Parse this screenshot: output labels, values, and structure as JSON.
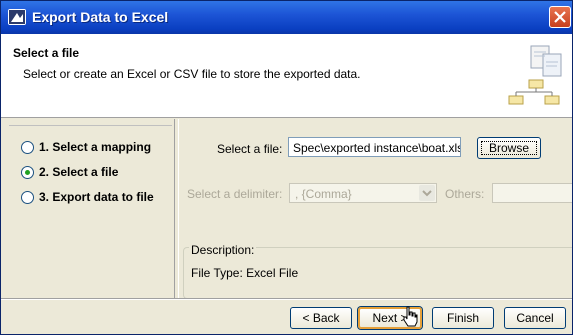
{
  "window": {
    "title": "Export Data to Excel"
  },
  "header": {
    "title": "Select a file",
    "description": "Select or create an Excel or CSV file to store the exported data."
  },
  "steps": [
    {
      "label": "1. Select a mapping",
      "selected": false
    },
    {
      "label": "2. Select a file",
      "selected": true
    },
    {
      "label": "3. Export data to file",
      "selected": false
    }
  ],
  "form": {
    "file_label": "Select a file:",
    "file_value": "Spec\\exported instance\\boat.xls",
    "browse_label": "Browse",
    "delimiter_label": "Select a delimiter:",
    "delimiter_value": ", {Comma}",
    "others_label": "Others:",
    "description_title": "Description:",
    "description_value": "File Type: Excel File"
  },
  "buttons": {
    "back": "< Back",
    "next": "Next >",
    "finish": "Finish",
    "cancel": "Cancel"
  }
}
